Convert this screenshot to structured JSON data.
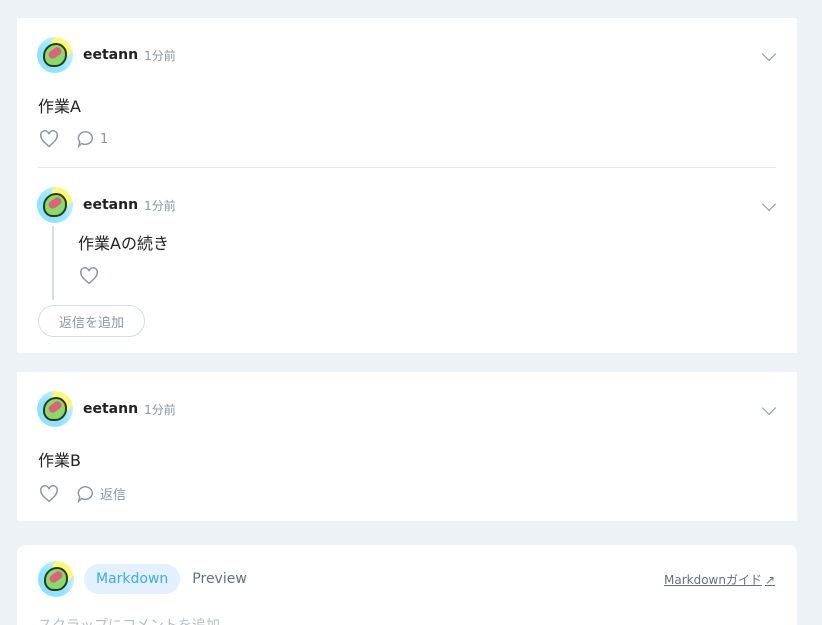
{
  "comments": [
    {
      "user": "eetann",
      "time": "1分前",
      "text": "作業A",
      "comment_count": "1",
      "reply": {
        "user": "eetann",
        "time": "1分前",
        "text": "作業Aの続き"
      },
      "add_reply_label": "返信を追加"
    },
    {
      "user": "eetann",
      "time": "1分前",
      "text": "作業B",
      "reply_label": "返信"
    }
  ],
  "editor": {
    "tab_markdown": "Markdown",
    "tab_preview": "Preview",
    "guide_label": "Markdownガイド",
    "guide_icon": "↗",
    "placeholder": "スクラップにコメントを追加"
  },
  "colors": {
    "accent": "#3ea8ff",
    "background": "#edf2f7",
    "muted": "#8a96a3"
  }
}
